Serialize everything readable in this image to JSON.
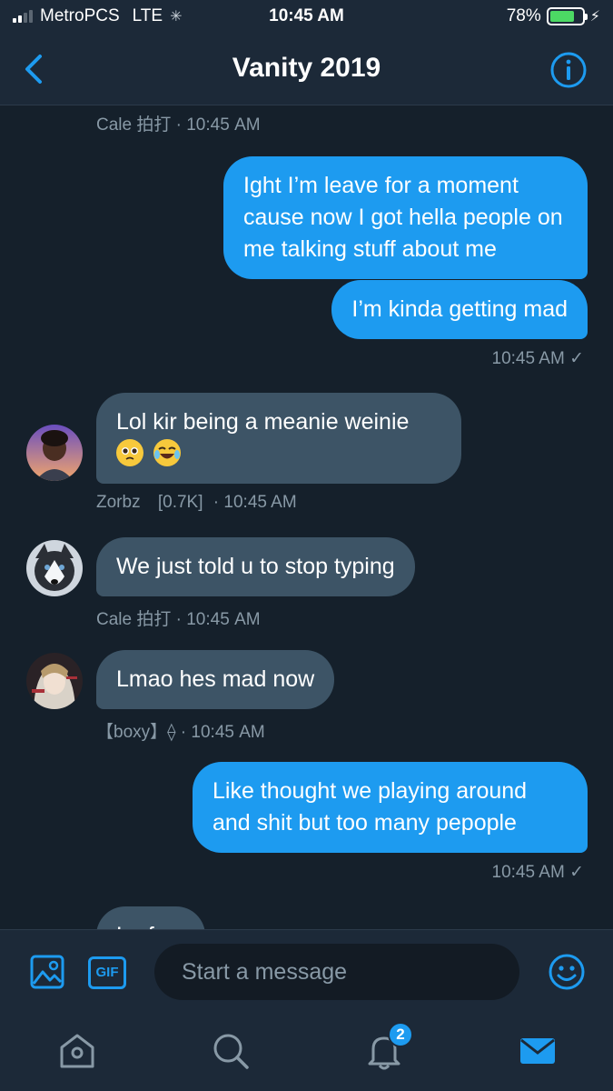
{
  "status_bar": {
    "carrier": "MetroPCS",
    "network": "LTE",
    "time": "10:45 AM",
    "battery": "78%",
    "battery_level": 0.78
  },
  "header": {
    "title": "Vanity 2019"
  },
  "messages": {
    "m0_meta": "Cale 拍打 · 10:45 AM",
    "m1_text": "Ight I’m leave for a moment cause now I got hella people on me talking stuff about me",
    "m2_text": "I’m kinda getting mad",
    "m2_meta": "10:45 AM ✓",
    "m3_text": "Lol kir being a meanie weinie",
    "m3_sender": "Zorbz",
    "m3_tag": "[0.7K]",
    "m3_time": "· 10:45 AM",
    "m4_text": "We just told u to stop typing",
    "m4_meta": "Cale 拍打 · 10:45 AM",
    "m5_text": "Lmao hes mad now",
    "m5_meta": "【boxy】⟠ · 10:45 AM",
    "m6_text": "Like thought we playing around and shit but too many pepople",
    "m6_meta": "10:45 AM ✓",
    "m7_text": "Lmfao"
  },
  "composer": {
    "gif_label": "GIF",
    "placeholder": "Start a message"
  },
  "tabbar": {
    "notifications_badge": "2"
  },
  "colors": {
    "accent": "#1d9bf0",
    "background": "#15202b",
    "incoming_bubble": "#3d5466"
  }
}
